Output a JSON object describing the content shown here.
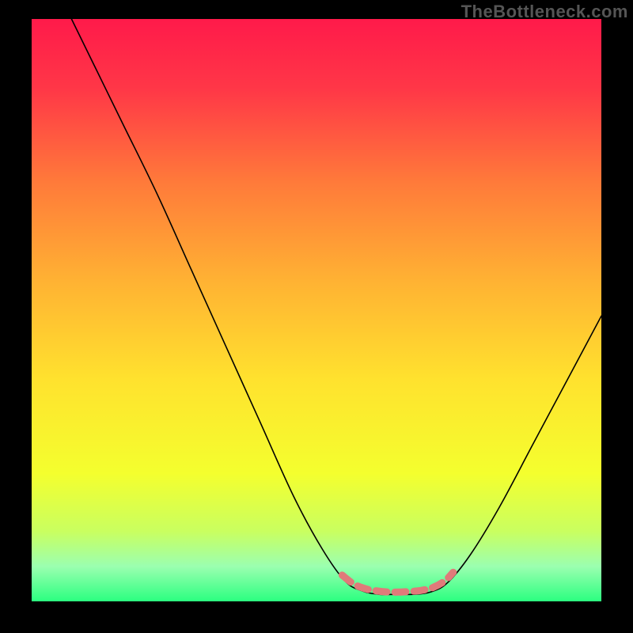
{
  "watermark": "TheBottleneck.com",
  "chart_data": {
    "type": "line",
    "title": "",
    "xlabel": "",
    "ylabel": "",
    "xlim": [
      0,
      100
    ],
    "ylim": [
      0,
      100
    ],
    "background_gradient": {
      "stops": [
        {
          "offset": 0.0,
          "color": "#ff1a4a"
        },
        {
          "offset": 0.12,
          "color": "#ff3747"
        },
        {
          "offset": 0.28,
          "color": "#ff7a3a"
        },
        {
          "offset": 0.45,
          "color": "#ffb233"
        },
        {
          "offset": 0.62,
          "color": "#ffe22e"
        },
        {
          "offset": 0.78,
          "color": "#f4ff2e"
        },
        {
          "offset": 0.88,
          "color": "#c9ff60"
        },
        {
          "offset": 0.94,
          "color": "#9bffb0"
        },
        {
          "offset": 1.0,
          "color": "#2bff80"
        }
      ]
    },
    "series": [
      {
        "name": "bottleneck-curve",
        "color": "#000000",
        "stroke_width": 1.6,
        "points": [
          {
            "x": 7.0,
            "y": 100.0
          },
          {
            "x": 11.0,
            "y": 92.0
          },
          {
            "x": 16.0,
            "y": 82.0
          },
          {
            "x": 22.0,
            "y": 70.0
          },
          {
            "x": 28.0,
            "y": 57.0
          },
          {
            "x": 34.0,
            "y": 44.0
          },
          {
            "x": 40.0,
            "y": 31.0
          },
          {
            "x": 46.0,
            "y": 18.0
          },
          {
            "x": 51.0,
            "y": 9.0
          },
          {
            "x": 55.0,
            "y": 3.5
          },
          {
            "x": 58.0,
            "y": 1.8
          },
          {
            "x": 61.0,
            "y": 1.2
          },
          {
            "x": 64.0,
            "y": 1.2
          },
          {
            "x": 67.0,
            "y": 1.2
          },
          {
            "x": 70.0,
            "y": 1.6
          },
          {
            "x": 73.0,
            "y": 3.2
          },
          {
            "x": 77.0,
            "y": 8.0
          },
          {
            "x": 82.0,
            "y": 16.0
          },
          {
            "x": 88.0,
            "y": 27.0
          },
          {
            "x": 94.0,
            "y": 38.0
          },
          {
            "x": 100.0,
            "y": 49.0
          }
        ]
      },
      {
        "name": "recommended-range-marker",
        "color": "#e07a7a",
        "stroke_width": 9,
        "dashed": true,
        "dash": "14 10",
        "points": [
          {
            "x": 54.5,
            "y": 4.5
          },
          {
            "x": 56.5,
            "y": 3.0
          },
          {
            "x": 58.5,
            "y": 2.2
          },
          {
            "x": 60.5,
            "y": 1.8
          },
          {
            "x": 62.5,
            "y": 1.6
          },
          {
            "x": 64.5,
            "y": 1.6
          },
          {
            "x": 66.5,
            "y": 1.7
          },
          {
            "x": 68.5,
            "y": 1.9
          },
          {
            "x": 70.5,
            "y": 2.4
          },
          {
            "x": 72.5,
            "y": 3.5
          },
          {
            "x": 74.0,
            "y": 5.0
          }
        ]
      }
    ]
  }
}
